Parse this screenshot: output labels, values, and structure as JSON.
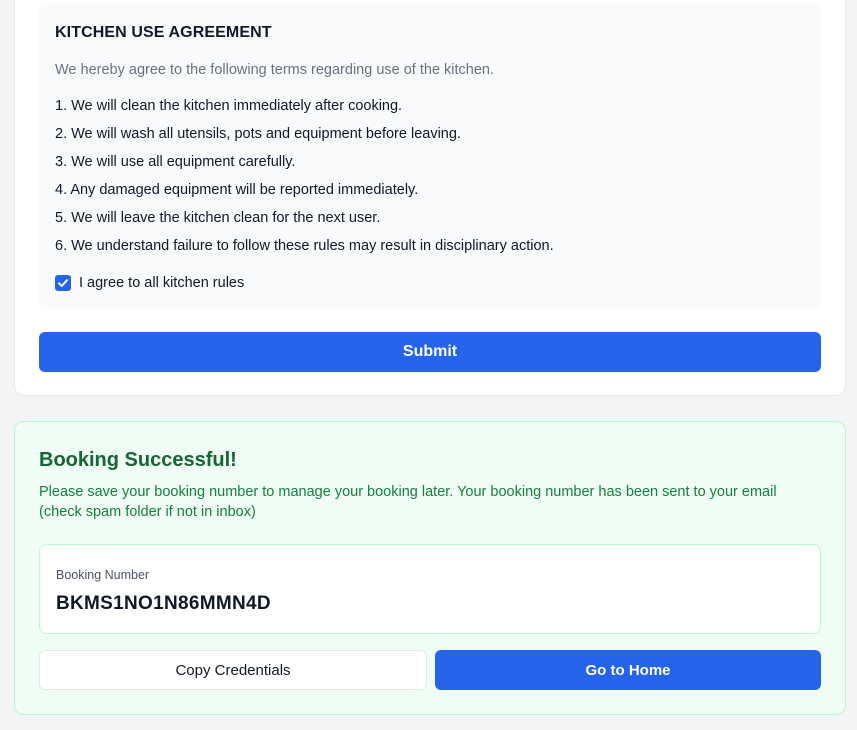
{
  "agreement": {
    "title": "KITCHEN USE AGREEMENT",
    "intro": "We hereby agree to the following terms regarding use of the kitchen.",
    "rules": [
      "1. We will clean the kitchen immediately after cooking.",
      "2. We will wash all utensils, pots and equipment before leaving.",
      "3. We will use all equipment carefully.",
      "4. Any damaged equipment will be reported immediately.",
      "5. We will leave the kitchen clean for the next user.",
      "6. We understand failure to follow these rules may result in disciplinary action."
    ],
    "checkbox_label": "I agree to all kitchen rules",
    "checked": true
  },
  "submit_label": "Submit",
  "success": {
    "title": "Booking Successful!",
    "message": "Please save your booking number to manage your booking later. Your booking number has been sent to your email (check spam folder if not in inbox)",
    "booking_label": "Booking Number",
    "booking_number": "BKMS1NO1N86MMN4D",
    "copy_label": "Copy Credentials",
    "home_label": "Go to Home"
  },
  "colors": {
    "primary": "#2563eb",
    "success_bg": "#f0fdf4",
    "success_text": "#166534"
  }
}
